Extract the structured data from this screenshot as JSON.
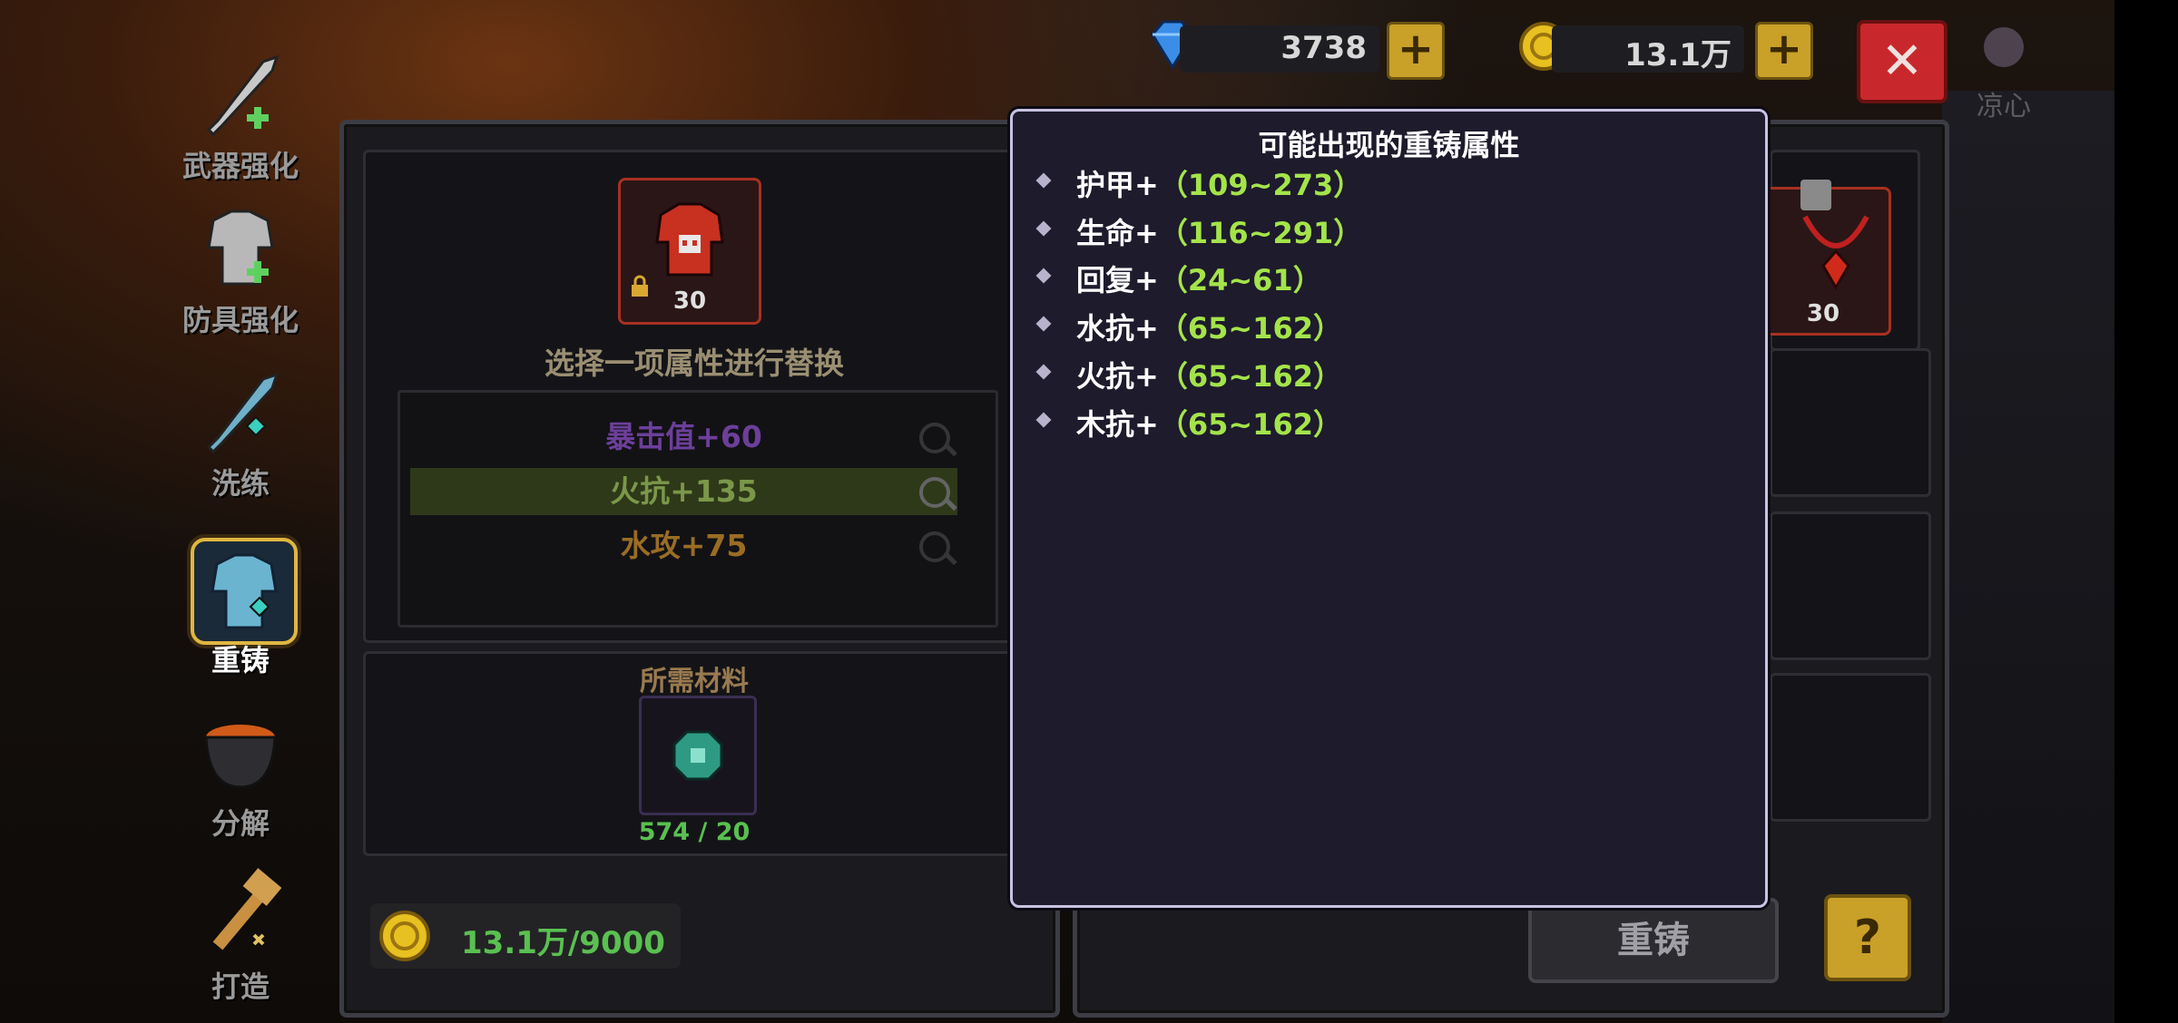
{
  "nav": {
    "items": [
      {
        "label": "武器强化"
      },
      {
        "label": "防具强化"
      },
      {
        "label": "洗练"
      },
      {
        "label": "重铸"
      },
      {
        "label": "分解"
      },
      {
        "label": "打造"
      }
    ]
  },
  "currency": {
    "gems": "3738",
    "gold": "13.1万",
    "add_label": "+"
  },
  "close_label": "✕",
  "user_name": "凉心",
  "left_panel": {
    "item_level": "30",
    "select_prompt": "选择一项属性进行替换",
    "stats": [
      {
        "label": "暴击值+60",
        "color": "#8a4fc7"
      },
      {
        "label": "火抗+135",
        "color": "#a8d060"
      },
      {
        "label": "水攻+75",
        "color": "#c88a2a"
      }
    ],
    "materials_label": "所需材料",
    "material_count": "574 / 20",
    "cost": "13.1万/9000"
  },
  "right_panel": {
    "item_level": "30",
    "reforge_button": "重铸",
    "help_label": "?"
  },
  "popup": {
    "title": "可能出现的重铸属性",
    "attributes": [
      {
        "name": "护甲+",
        "range": "（109~273）"
      },
      {
        "name": "生命+",
        "range": "（116~291）"
      },
      {
        "name": "回复+",
        "range": "（24~61）"
      },
      {
        "name": "水抗+",
        "range": "（65~162）"
      },
      {
        "name": "火抗+",
        "range": "（65~162）"
      },
      {
        "name": "木抗+",
        "range": "（65~162）"
      }
    ]
  },
  "colors": {
    "popup_bg": "#1e1b2c",
    "range_green": "#a4e44a",
    "gold_button": "#c9a028",
    "close_red": "#c8282c"
  }
}
